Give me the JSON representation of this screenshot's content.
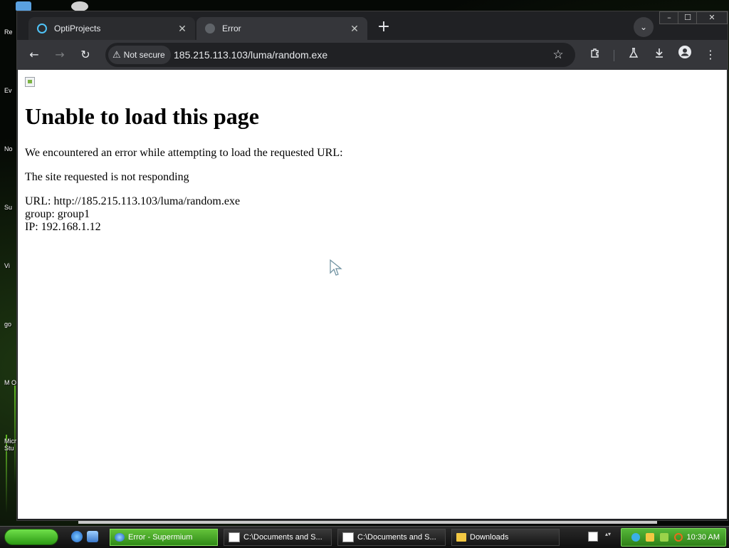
{
  "desktop": {
    "icon_labels": [
      "Re",
      "Ev",
      "No",
      "Su",
      "Vi",
      "go",
      "M O",
      "Micro Stu"
    ]
  },
  "browser": {
    "tabs": [
      {
        "title": "OptiProjects",
        "close": "✕"
      },
      {
        "title": "Error",
        "close": "✕"
      }
    ],
    "new_tab": "+",
    "tab_search": "⌄",
    "window_controls": {
      "minimize": "–",
      "maximize": "☐",
      "close": "✕"
    },
    "nav": {
      "back": "←",
      "forward": "→",
      "reload": "↻"
    },
    "security_label": "Not secure",
    "url": "185.215.113.103/luma/random.exe",
    "toolbar_icons": [
      "star-icon",
      "extensions-icon",
      "labs-icon",
      "download-icon",
      "profile-icon",
      "menu-icon"
    ]
  },
  "page": {
    "heading": "Unable to load this page",
    "lines": [
      "We encountered an error while attempting to load the requested URL:",
      "The site requested is not responding",
      "URL: http://185.215.113.103/luma/random.exe",
      "group: group1",
      "IP: 192.168.1.12"
    ]
  },
  "taskbar": {
    "buttons": [
      "Error - Supermium",
      "C:\\Documents and S...",
      "C:\\Documents and S...",
      "Downloads"
    ],
    "clock": "10:30 AM"
  },
  "colors": {
    "chrome_dark": "#202124",
    "chrome_toolbar": "#35363a",
    "xp_green": "#3aa51c"
  }
}
